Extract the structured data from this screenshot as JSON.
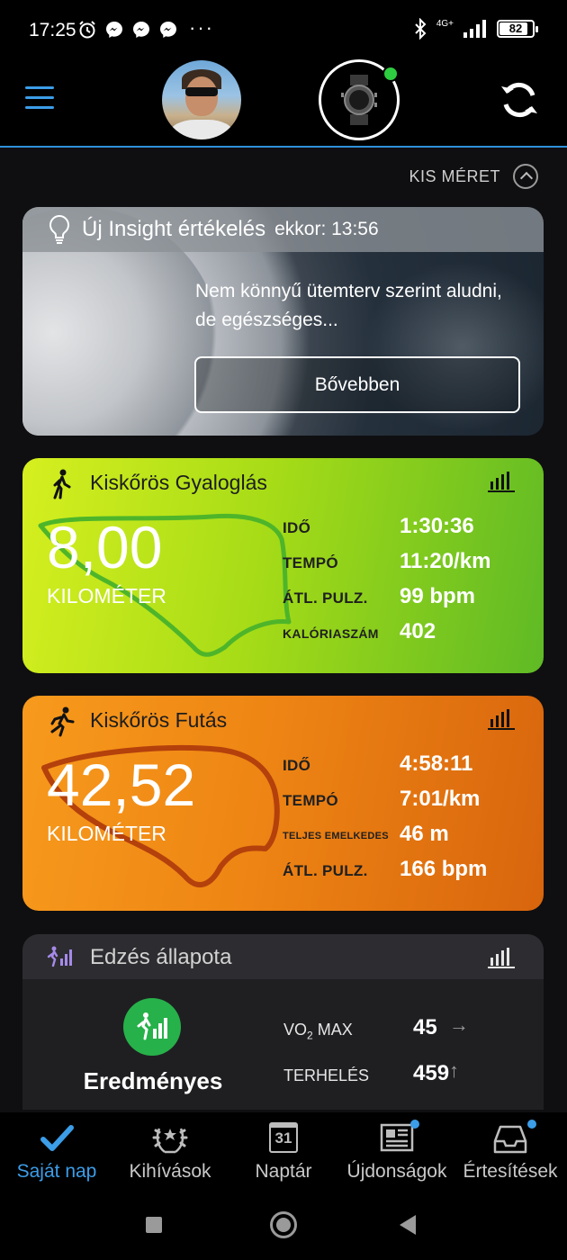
{
  "status_bar": {
    "time": "17:25",
    "dots": "···",
    "network": "4G+",
    "battery": "82"
  },
  "header": {
    "menu_icon": "hamburger-icon",
    "avatar": "user-avatar",
    "device": "watch-icon",
    "device_status_color": "#2ecc40",
    "sync_icon": "sync-icon",
    "accent": "#3c9de8"
  },
  "size_toggle": {
    "label": "KIS MÉRET"
  },
  "insight": {
    "title": "Új Insight értékelés",
    "time_text": "ekkor: 13:56",
    "body": "Nem könnyű ütemterv szerint aludni, de egészséges...",
    "button": "Bővebben"
  },
  "walk_card": {
    "title": "Kiskőrös Gyaloglás",
    "distance": "8,00",
    "unit": "KILOMÉTER",
    "stats": [
      {
        "label": "IDŐ",
        "value": "1:30:36"
      },
      {
        "label": "TEMPÓ",
        "value": "11:20/km"
      },
      {
        "label": "ÁTL. PULZ.",
        "value": "99 bpm"
      },
      {
        "label": "KALÓRIASZÁM",
        "value": "402"
      }
    ]
  },
  "run_card": {
    "title": "Kiskőrös Futás",
    "distance": "42,52",
    "unit": "KILOMÉTER",
    "stats": [
      {
        "label": "IDŐ",
        "value": "4:58:11"
      },
      {
        "label": "TEMPÓ",
        "value": "7:01/km"
      },
      {
        "label": "TELJES EMELKEDES",
        "value": "46 m"
      },
      {
        "label": "ÁTL. PULZ.",
        "value": "166 bpm"
      }
    ]
  },
  "training": {
    "title": "Edzés állapota",
    "status": "Eredményes",
    "vo2_label": "VO",
    "vo2_sub": "2",
    "vo2_suffix": " MAX",
    "vo2_value": "45",
    "vo2_trend": "→",
    "load_label": "TERHELÉS",
    "load_value": "459",
    "load_trend": "↑"
  },
  "bottom_nav": [
    {
      "label": "Saját nap",
      "icon": "checkmark-icon",
      "active": true
    },
    {
      "label": "Kihívások",
      "icon": "laurel-icon",
      "active": false
    },
    {
      "label": "Naptár",
      "icon": "calendar-icon",
      "active": false,
      "day": "31"
    },
    {
      "label": "Újdonságok",
      "icon": "newspaper-icon",
      "active": false,
      "badge": true
    },
    {
      "label": "Értesítések",
      "icon": "inbox-icon",
      "active": false,
      "badge": true
    }
  ]
}
